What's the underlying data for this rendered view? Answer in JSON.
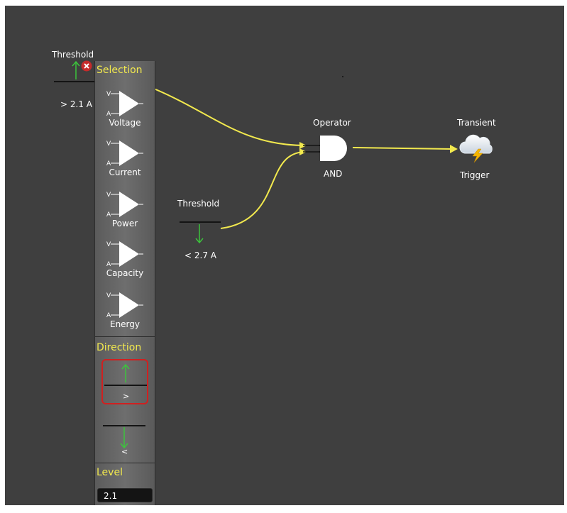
{
  "threshold1": {
    "title": "Threshold",
    "value": "> 2.1 A"
  },
  "threshold2": {
    "title": "Threshold",
    "value": "< 2.7 A"
  },
  "operator": {
    "title": "Operator",
    "value": "AND"
  },
  "trigger": {
    "title": "Transient",
    "value": "Trigger"
  },
  "palette": {
    "selection_title": "Selection",
    "items": [
      {
        "label": "Voltage"
      },
      {
        "label": "Current"
      },
      {
        "label": "Power"
      },
      {
        "label": "Capacity"
      },
      {
        "label": "Energy"
      }
    ],
    "direction_title": "Direction",
    "direction_up_label": ">",
    "direction_down_label": "<",
    "level_title": "Level",
    "level_value": "2.1"
  },
  "colors": {
    "canvas": "#3f3f3f",
    "wire": "#f2e94e",
    "accent_text": "#f2e94e",
    "arrow_green": "#3cc43c",
    "selected_border": "#d02020",
    "delete_badge": "#c62b2b"
  },
  "icons": [
    "arrow-up-icon",
    "arrow-down-icon",
    "delete-icon",
    "amplifier-icon",
    "and-gate-icon",
    "storm-cloud-icon"
  ]
}
